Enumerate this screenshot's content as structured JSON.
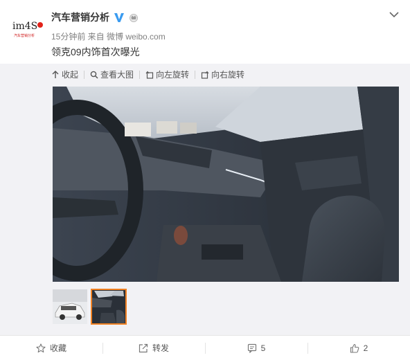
{
  "author": {
    "avatar_text": "im4S",
    "avatar_subtext": "汽车营销分析",
    "name": "汽车营销分析"
  },
  "post": {
    "meta": "15分钟前 来自 微博 weibo.com",
    "text": "领克09内饰首次曝光"
  },
  "media_toolbar": {
    "collapse": "收起",
    "view_large": "查看大图",
    "rotate_left": "向左旋转",
    "rotate_right": "向右旋转"
  },
  "actions": {
    "favorite": "收藏",
    "repost": "转发",
    "comment_count": "5",
    "like_count": "2"
  },
  "colors": {
    "accent_orange": "#f28223",
    "verify_blue": "#3a9bf0",
    "text_gray": "#808080"
  },
  "icons": [
    "chevron-down-icon",
    "verified-icon",
    "member-crown-icon",
    "collapse-arrow-icon",
    "magnifier-icon",
    "rotate-left-icon",
    "rotate-right-icon",
    "star-icon",
    "repost-icon",
    "comment-icon",
    "thumbs-up-icon"
  ]
}
